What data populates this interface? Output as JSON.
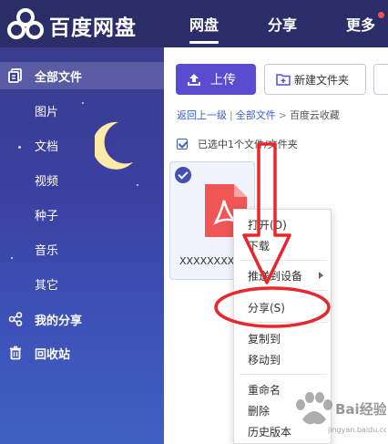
{
  "header": {
    "brand": "百度网盘",
    "nav": [
      {
        "label": "网盘",
        "active": true
      },
      {
        "label": "分享",
        "active": false
      },
      {
        "label": "更多",
        "active": false
      }
    ]
  },
  "sidebar": {
    "items": [
      {
        "label": "全部文件",
        "icon": "files-icon",
        "active": true
      },
      {
        "label": "图片"
      },
      {
        "label": "文档"
      },
      {
        "label": "视频"
      },
      {
        "label": "种子"
      },
      {
        "label": "音乐"
      },
      {
        "label": "其它"
      },
      {
        "label": "我的分享",
        "icon": "share-icon"
      },
      {
        "label": "回收站",
        "icon": "trash-icon"
      }
    ]
  },
  "toolbar": {
    "upload_label": "上传",
    "new_folder_label": "新建文件夹"
  },
  "breadcrumb": {
    "back": "返回上一级",
    "sep": "|",
    "all_files": "全部文件",
    "arrow": ">",
    "current": "百度云收藏"
  },
  "selection": {
    "text": "已选中1个文件/文件夹"
  },
  "file": {
    "name": "XXXXXXXX"
  },
  "context_menu": {
    "items": [
      "打开(O)",
      "下载",
      "推送到设备",
      "分享(S)",
      "复制到",
      "移动到",
      "重命名",
      "删除",
      "历史版本"
    ]
  },
  "watermark": {
    "text": "Bai经验",
    "sub": "jingyan.baidu.com"
  },
  "colors": {
    "header_bg": "#2a2d68",
    "accent": "#5a4bd1",
    "link": "#3a5fcd",
    "annotation_red": "#e8262b"
  }
}
